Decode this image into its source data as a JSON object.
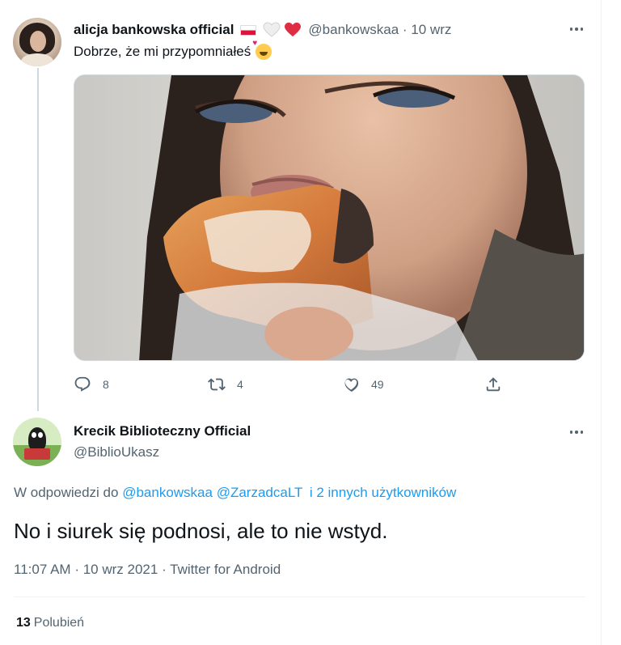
{
  "tweet_original": {
    "display_name": "alicja bankowska official",
    "handle": "@bankowskaa",
    "date": "10 wrz",
    "text": "Dobrze, że mi przypomniałeś",
    "emoji_icon": "smiling-face-with-hearts-icon",
    "name_emojis": [
      "poland-flag-icon",
      "white-heart-icon",
      "red-heart-icon"
    ],
    "stats": {
      "replies": "8",
      "retweets": "4",
      "likes": "49"
    }
  },
  "tweet_reply": {
    "display_name": "Krecik Biblioteczny Official",
    "handle": "@BiblioUkasz",
    "reply_prefix": "W odpowiedzi do",
    "reply_to": [
      "@bankowskaa",
      "@ZarzadcaLT",
      "i 2 innych użytkowników"
    ],
    "text": "No i siurek się podnosi, ale to nie wstyd.",
    "time": "11:07 AM",
    "date": "10 wrz 2021",
    "source": "Twitter for Android",
    "likes_count": "13",
    "likes_label": "Polubień"
  },
  "colors": {
    "link": "#1d9bf0",
    "muted": "#536471",
    "text": "#0f1419"
  }
}
